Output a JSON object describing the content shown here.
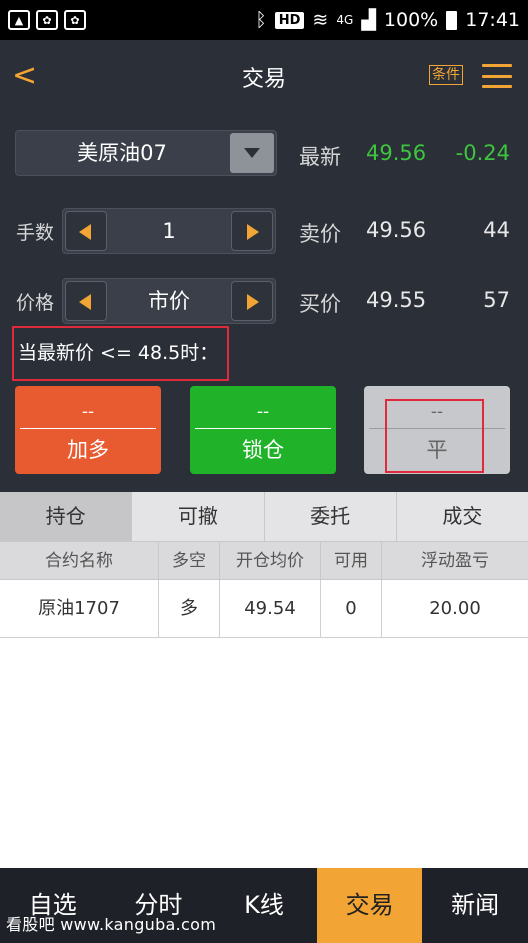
{
  "status_bar": {
    "hd": "HD",
    "network": "4G",
    "battery": "100%",
    "time": "17:41"
  },
  "header": {
    "title": "交易",
    "condition_badge": "条件"
  },
  "contract_select": {
    "value": "美原油07"
  },
  "quote": {
    "latest_label": "最新",
    "latest_price": "49.56",
    "latest_change": "-0.24",
    "ask_label": "卖价",
    "ask_price": "49.56",
    "ask_volume": "44",
    "bid_label": "买价",
    "bid_price": "49.55",
    "bid_volume": "57"
  },
  "quantity": {
    "label": "手数",
    "value": "1"
  },
  "price": {
    "label": "价格",
    "value": "市价"
  },
  "condition_text": "当最新价 <= 48.5时：",
  "actions": [
    {
      "value": "--",
      "label": "加多"
    },
    {
      "value": "--",
      "label": "锁仓"
    },
    {
      "value": "--",
      "label": "平"
    }
  ],
  "tabs": [
    "持仓",
    "可撤",
    "委托",
    "成交"
  ],
  "table": {
    "headers": [
      "合约名称",
      "多空",
      "开仓均价",
      "可用",
      "浮动盈亏"
    ],
    "rows": [
      [
        "原油1707",
        "多",
        "49.54",
        "0",
        "20.00"
      ]
    ]
  },
  "bottom_nav": [
    "自选",
    "分时",
    "K线",
    "交易",
    "新闻"
  ],
  "watermark": "看股吧 www.kanguba.com",
  "colors": {
    "accent": "#f2a534",
    "up_green": "#3ec43e",
    "add_button": "#e85a30",
    "lock_button": "#20b32a",
    "highlight_red": "#e0293a"
  }
}
